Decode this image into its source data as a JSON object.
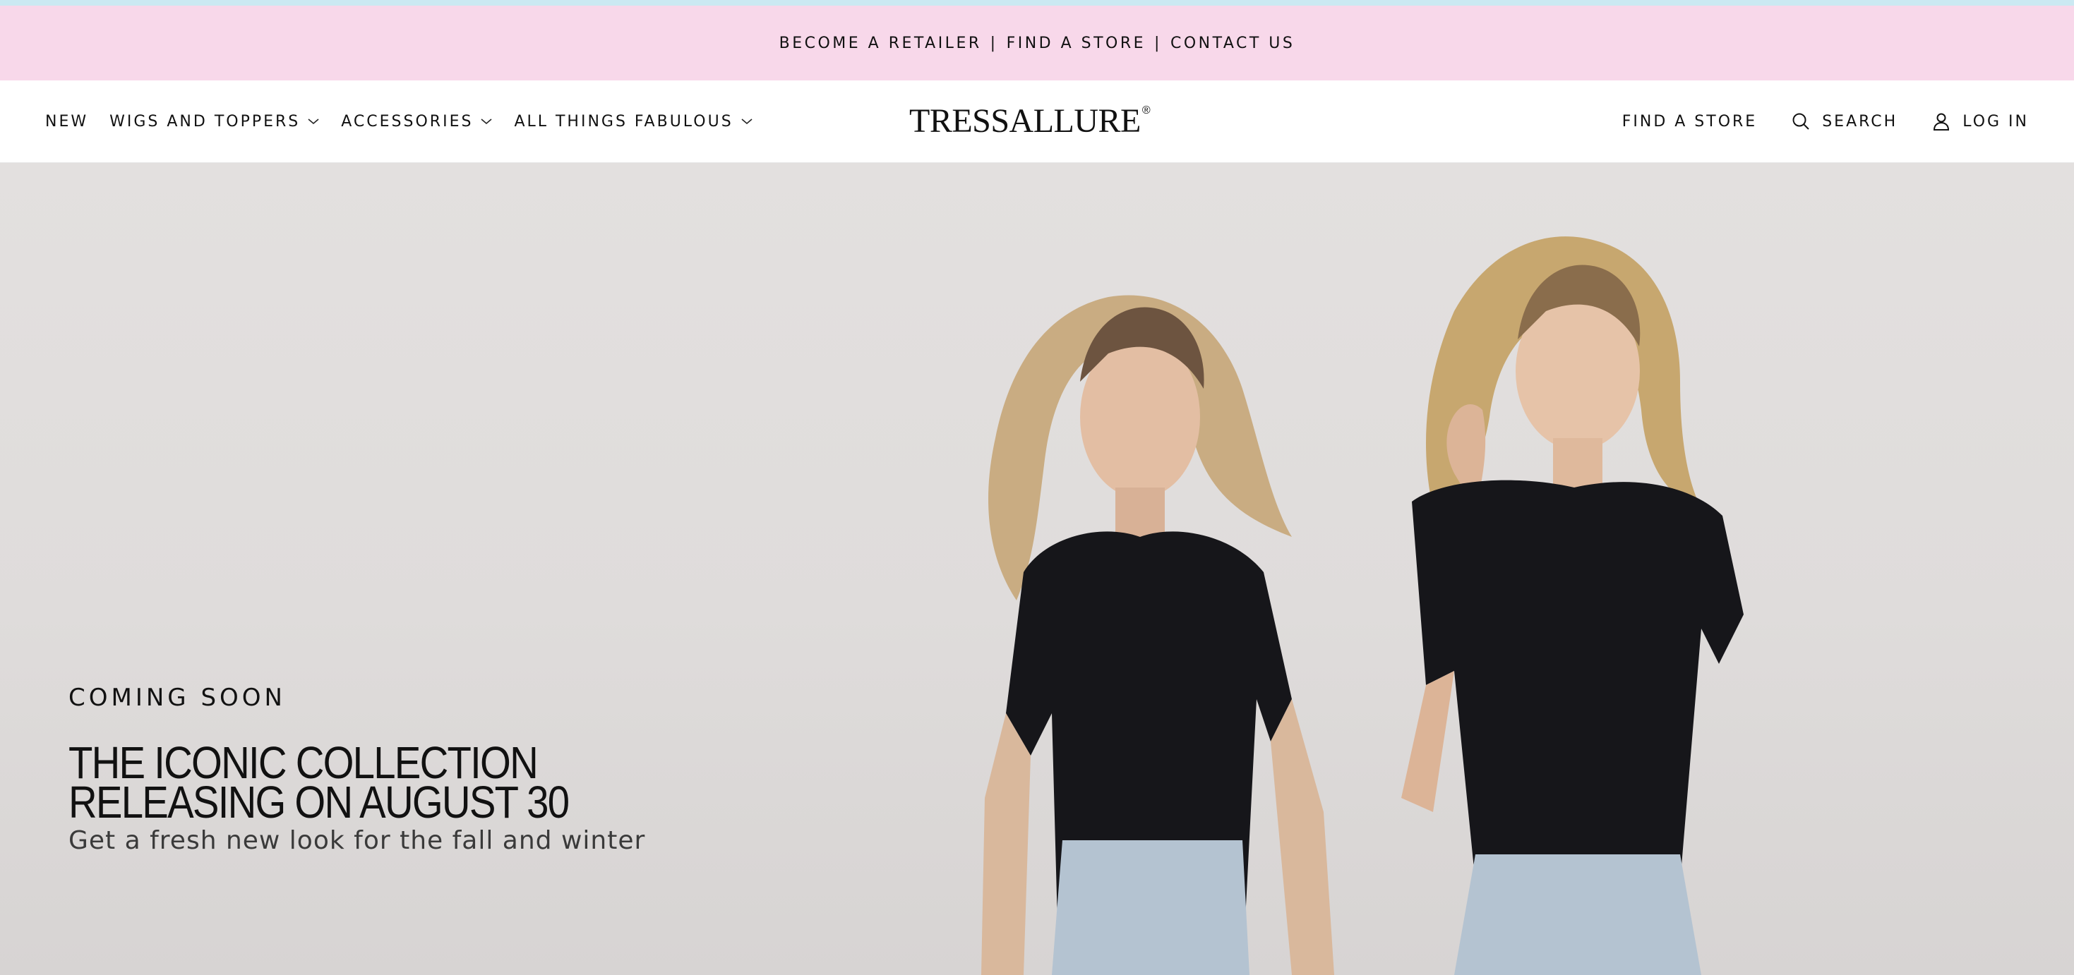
{
  "announcement": {
    "links": [
      "BECOME A RETAILER",
      "FIND A STORE",
      "CONTACT US"
    ],
    "separator": "|"
  },
  "nav": {
    "left": [
      {
        "label": "NEW",
        "has_dropdown": false
      },
      {
        "label": "WIGS AND TOPPERS",
        "has_dropdown": true
      },
      {
        "label": "ACCESSORIES",
        "has_dropdown": true
      },
      {
        "label": "ALL THINGS FABULOUS",
        "has_dropdown": true
      }
    ],
    "right": {
      "find_store": "FIND A STORE",
      "search": "SEARCH",
      "login": "LOG IN"
    }
  },
  "logo": {
    "text": "TRESSALLURE",
    "mark": "®"
  },
  "hero": {
    "eyebrow": "COMING SOON",
    "headline_line1": "THE ICONIC COLLECTION",
    "headline_line2": "RELEASING ON AUGUST 30",
    "subhead": "Get a fresh new look for the fall and winter"
  },
  "icons": {
    "search": "search-icon",
    "account": "user-icon",
    "dropdown": "chevron-down-icon"
  },
  "colors": {
    "announcement_bg": "#f8d8ea",
    "top_accent": "#cbe9f2",
    "hero_bg": "#e0dddc",
    "shirt": "#16161a",
    "denim": "#b4c3d1"
  }
}
